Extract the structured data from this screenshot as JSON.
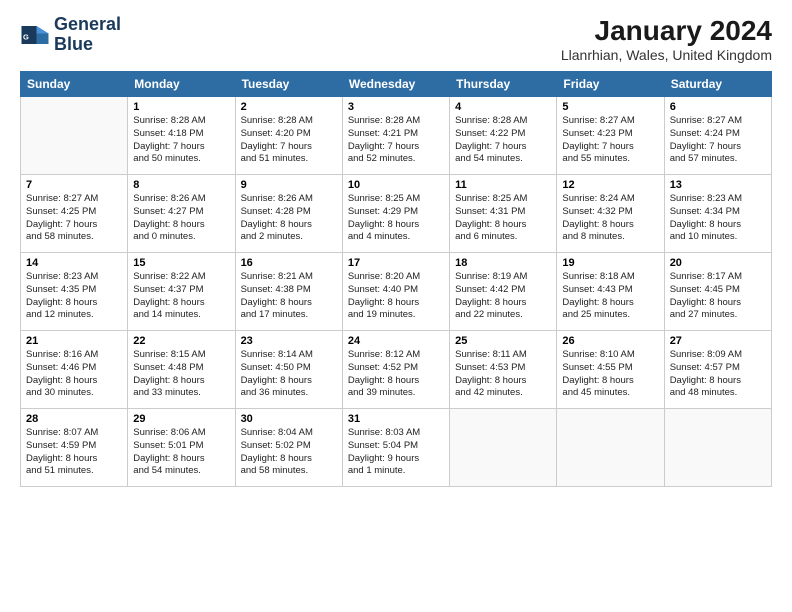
{
  "logo": {
    "line1": "General",
    "line2": "Blue"
  },
  "title": "January 2024",
  "subtitle": "Llanrhian, Wales, United Kingdom",
  "weekdays": [
    "Sunday",
    "Monday",
    "Tuesday",
    "Wednesday",
    "Thursday",
    "Friday",
    "Saturday"
  ],
  "weeks": [
    [
      {
        "day": "",
        "info": ""
      },
      {
        "day": "1",
        "info": "Sunrise: 8:28 AM\nSunset: 4:18 PM\nDaylight: 7 hours\nand 50 minutes."
      },
      {
        "day": "2",
        "info": "Sunrise: 8:28 AM\nSunset: 4:20 PM\nDaylight: 7 hours\nand 51 minutes."
      },
      {
        "day": "3",
        "info": "Sunrise: 8:28 AM\nSunset: 4:21 PM\nDaylight: 7 hours\nand 52 minutes."
      },
      {
        "day": "4",
        "info": "Sunrise: 8:28 AM\nSunset: 4:22 PM\nDaylight: 7 hours\nand 54 minutes."
      },
      {
        "day": "5",
        "info": "Sunrise: 8:27 AM\nSunset: 4:23 PM\nDaylight: 7 hours\nand 55 minutes."
      },
      {
        "day": "6",
        "info": "Sunrise: 8:27 AM\nSunset: 4:24 PM\nDaylight: 7 hours\nand 57 minutes."
      }
    ],
    [
      {
        "day": "7",
        "info": "Sunrise: 8:27 AM\nSunset: 4:25 PM\nDaylight: 7 hours\nand 58 minutes."
      },
      {
        "day": "8",
        "info": "Sunrise: 8:26 AM\nSunset: 4:27 PM\nDaylight: 8 hours\nand 0 minutes."
      },
      {
        "day": "9",
        "info": "Sunrise: 8:26 AM\nSunset: 4:28 PM\nDaylight: 8 hours\nand 2 minutes."
      },
      {
        "day": "10",
        "info": "Sunrise: 8:25 AM\nSunset: 4:29 PM\nDaylight: 8 hours\nand 4 minutes."
      },
      {
        "day": "11",
        "info": "Sunrise: 8:25 AM\nSunset: 4:31 PM\nDaylight: 8 hours\nand 6 minutes."
      },
      {
        "day": "12",
        "info": "Sunrise: 8:24 AM\nSunset: 4:32 PM\nDaylight: 8 hours\nand 8 minutes."
      },
      {
        "day": "13",
        "info": "Sunrise: 8:23 AM\nSunset: 4:34 PM\nDaylight: 8 hours\nand 10 minutes."
      }
    ],
    [
      {
        "day": "14",
        "info": "Sunrise: 8:23 AM\nSunset: 4:35 PM\nDaylight: 8 hours\nand 12 minutes."
      },
      {
        "day": "15",
        "info": "Sunrise: 8:22 AM\nSunset: 4:37 PM\nDaylight: 8 hours\nand 14 minutes."
      },
      {
        "day": "16",
        "info": "Sunrise: 8:21 AM\nSunset: 4:38 PM\nDaylight: 8 hours\nand 17 minutes."
      },
      {
        "day": "17",
        "info": "Sunrise: 8:20 AM\nSunset: 4:40 PM\nDaylight: 8 hours\nand 19 minutes."
      },
      {
        "day": "18",
        "info": "Sunrise: 8:19 AM\nSunset: 4:42 PM\nDaylight: 8 hours\nand 22 minutes."
      },
      {
        "day": "19",
        "info": "Sunrise: 8:18 AM\nSunset: 4:43 PM\nDaylight: 8 hours\nand 25 minutes."
      },
      {
        "day": "20",
        "info": "Sunrise: 8:17 AM\nSunset: 4:45 PM\nDaylight: 8 hours\nand 27 minutes."
      }
    ],
    [
      {
        "day": "21",
        "info": "Sunrise: 8:16 AM\nSunset: 4:46 PM\nDaylight: 8 hours\nand 30 minutes."
      },
      {
        "day": "22",
        "info": "Sunrise: 8:15 AM\nSunset: 4:48 PM\nDaylight: 8 hours\nand 33 minutes."
      },
      {
        "day": "23",
        "info": "Sunrise: 8:14 AM\nSunset: 4:50 PM\nDaylight: 8 hours\nand 36 minutes."
      },
      {
        "day": "24",
        "info": "Sunrise: 8:12 AM\nSunset: 4:52 PM\nDaylight: 8 hours\nand 39 minutes."
      },
      {
        "day": "25",
        "info": "Sunrise: 8:11 AM\nSunset: 4:53 PM\nDaylight: 8 hours\nand 42 minutes."
      },
      {
        "day": "26",
        "info": "Sunrise: 8:10 AM\nSunset: 4:55 PM\nDaylight: 8 hours\nand 45 minutes."
      },
      {
        "day": "27",
        "info": "Sunrise: 8:09 AM\nSunset: 4:57 PM\nDaylight: 8 hours\nand 48 minutes."
      }
    ],
    [
      {
        "day": "28",
        "info": "Sunrise: 8:07 AM\nSunset: 4:59 PM\nDaylight: 8 hours\nand 51 minutes."
      },
      {
        "day": "29",
        "info": "Sunrise: 8:06 AM\nSunset: 5:01 PM\nDaylight: 8 hours\nand 54 minutes."
      },
      {
        "day": "30",
        "info": "Sunrise: 8:04 AM\nSunset: 5:02 PM\nDaylight: 8 hours\nand 58 minutes."
      },
      {
        "day": "31",
        "info": "Sunrise: 8:03 AM\nSunset: 5:04 PM\nDaylight: 9 hours\nand 1 minute."
      },
      {
        "day": "",
        "info": ""
      },
      {
        "day": "",
        "info": ""
      },
      {
        "day": "",
        "info": ""
      }
    ]
  ]
}
